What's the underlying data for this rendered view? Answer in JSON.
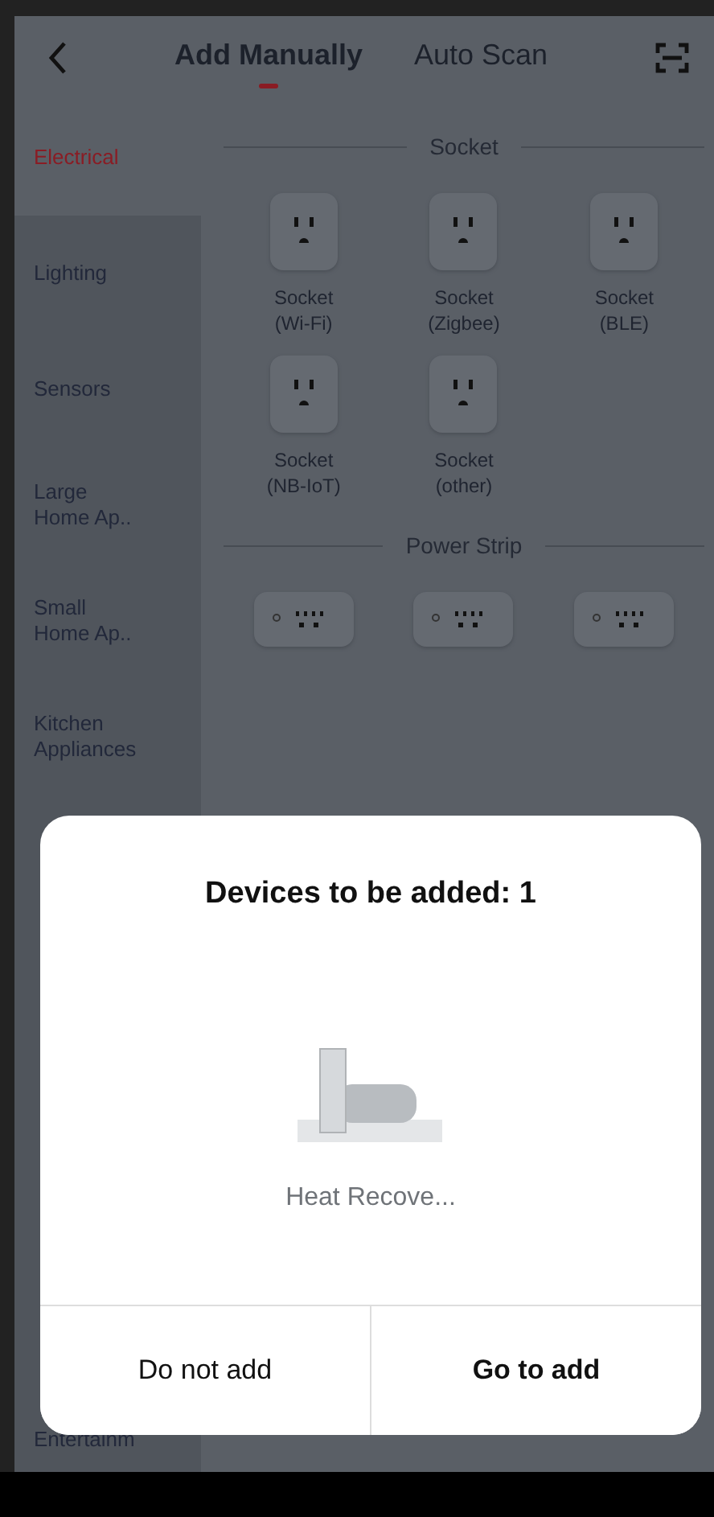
{
  "tabs": [
    {
      "label": "Add Manually",
      "selected": true
    },
    {
      "label": "Auto Scan",
      "selected": false
    }
  ],
  "sidebar": {
    "items": [
      {
        "label": "Electrical",
        "selected": true
      },
      {
        "label": "Lighting",
        "selected": false
      },
      {
        "label": "Sensors",
        "selected": false
      },
      {
        "label": "Large\nHome Ap..",
        "selected": false
      },
      {
        "label": "Small\nHome Ap..",
        "selected": false
      },
      {
        "label": "Kitchen\nAppliances",
        "selected": false
      },
      {
        "label": "Entertainm",
        "selected": false
      }
    ]
  },
  "sections": [
    {
      "title": "Socket",
      "devices": [
        {
          "kind": "socket",
          "name": "Socket\n(Wi-Fi)"
        },
        {
          "kind": "socket",
          "name": "Socket\n(Zigbee)"
        },
        {
          "kind": "socket",
          "name": "Socket\n(BLE)"
        },
        {
          "kind": "socket",
          "name": "Socket\n(NB-IoT)"
        },
        {
          "kind": "socket",
          "name": "Socket\n(other)"
        }
      ]
    },
    {
      "title": "Power Strip",
      "devices": [
        {
          "kind": "power_strip"
        },
        {
          "kind": "power_strip"
        },
        {
          "kind": "power_strip"
        }
      ]
    }
  ],
  "dialog": {
    "title": "Devices to be added: 1",
    "device_name": "Heat Recove...",
    "buttons": [
      {
        "label": "Do not add",
        "primary": false
      },
      {
        "label": "Go to add",
        "primary": true
      }
    ]
  }
}
